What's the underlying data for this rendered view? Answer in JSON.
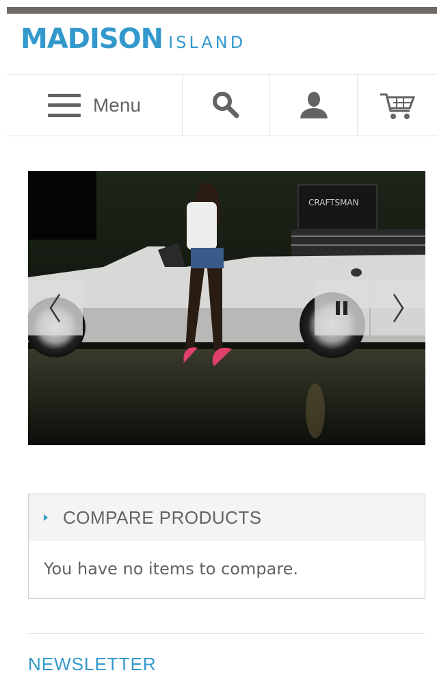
{
  "brand": {
    "name": "MADISON",
    "suffix": "ISLAND",
    "color": "#3399cc"
  },
  "nav": {
    "menu_label": "Menu",
    "icons": [
      "hamburger-icon",
      "search-icon",
      "account-icon",
      "cart-icon"
    ]
  },
  "slideshow": {
    "prev": "prev-arrow-icon",
    "pause": "pause-icon",
    "next": "next-arrow-icon",
    "image_sign": "CRAFTSMAN"
  },
  "compare": {
    "title": "COMPARE PRODUCTS",
    "empty_text": "You have no items to compare."
  },
  "newsletter": {
    "title": "NEWSLETTER"
  },
  "colors": {
    "accent": "#3399cc",
    "topbar": "#6e6962",
    "text": "#636363",
    "border": "#e6e6e6"
  }
}
